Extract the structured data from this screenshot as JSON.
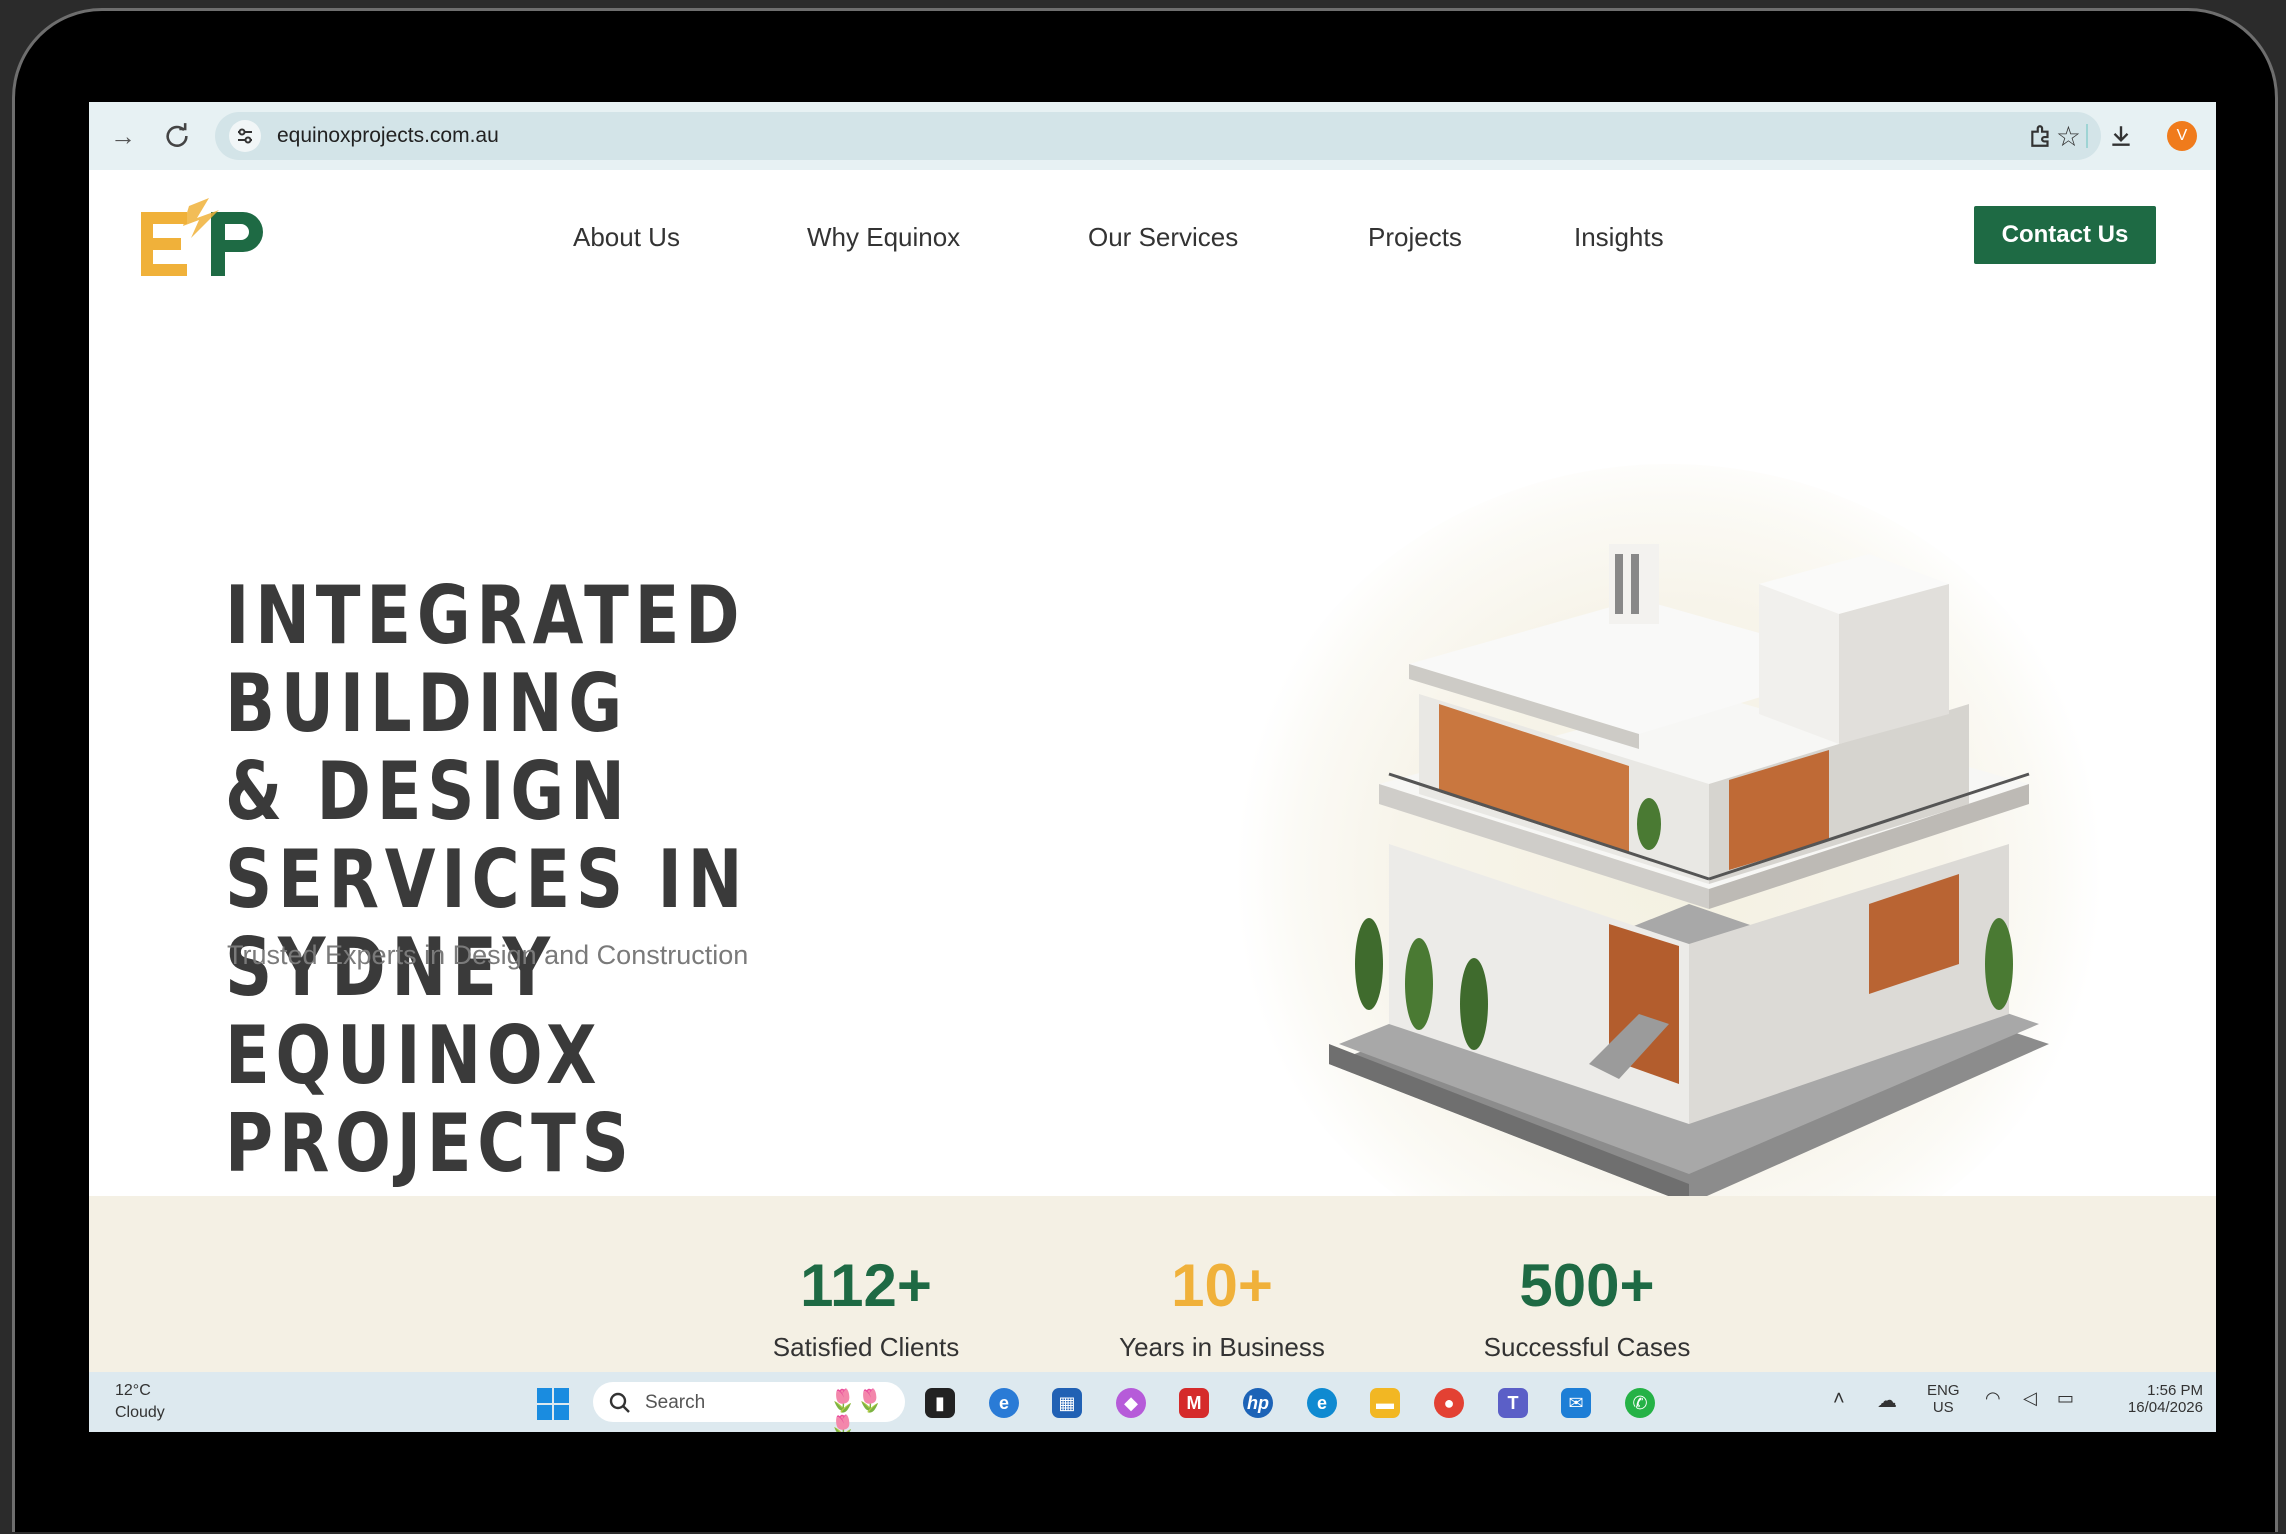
{
  "browser": {
    "url": "equinoxprojects.com.au",
    "profile_initial": "V"
  },
  "site": {
    "logo_letters": "EP",
    "nav": [
      "About Us",
      "Why Equinox",
      "Our Services",
      "Projects",
      "Insights"
    ],
    "contact_label": "Contact Us",
    "brand_colors": {
      "green": "#1e6a44",
      "gold": "#f0b13a"
    }
  },
  "hero": {
    "title": "INTEGRATED BUILDING\n& DESIGN SERVICES IN\nSYDNEY\nEQUINOX PROJECTS",
    "subtitle": "Trusted Experts in Design and Construction"
  },
  "stats": [
    {
      "value": "112+",
      "label": "Satisfied Clients",
      "color": "#1e6a44"
    },
    {
      "value": "10+",
      "label": "Years in Business",
      "color": "#f0b13a"
    },
    {
      "value": "500+",
      "label": "Successful Cases",
      "color": "#1e6a44"
    }
  ],
  "taskbar": {
    "weather_temp": "12°C",
    "weather_cond": "Cloudy",
    "search_label": "Search",
    "lang_1": "ENG",
    "lang_2": "US",
    "time": "1:56 PM",
    "date": "16/04/2026"
  }
}
